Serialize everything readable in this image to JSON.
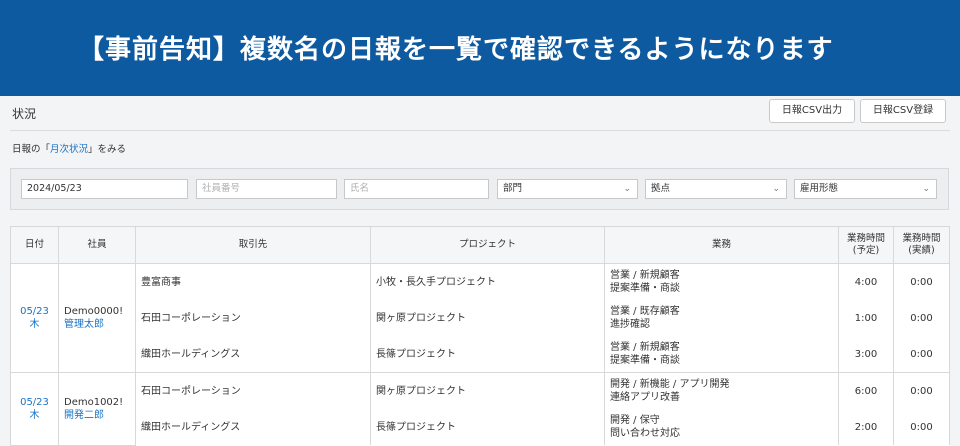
{
  "banner": {
    "text": "【事前告知】複数名の日報を一覧で確認できるようになります"
  },
  "page": {
    "title": "状況",
    "export_button": "日報CSV出力",
    "import_button": "日報CSV登録",
    "link_prefix": "日報の「",
    "link_text": "月次状況",
    "link_suffix": "」をみる"
  },
  "filters": {
    "date": "2024/05/23",
    "employee_no_placeholder": "社員番号",
    "name_placeholder": "氏名",
    "department": "部門",
    "base": "拠点",
    "employment_type": "雇用形態"
  },
  "table": {
    "headers": {
      "date": "日付",
      "employee": "社員",
      "client": "取引先",
      "project": "プロジェクト",
      "work": "業務",
      "planned_1": "業務時間",
      "planned_2": "(予定)",
      "actual_1": "業務時間",
      "actual_2": "(実績)"
    },
    "groups": [
      {
        "date": "05/23 木",
        "employee_id": "Demo0000!",
        "employee_name": "管理太郎",
        "rows": [
          {
            "client": "豊富商事",
            "project": "小牧・長久手プロジェクト",
            "work1": "営業 / 新規顧客",
            "work2": "提案準備・商談",
            "planned": "4:00",
            "actual": "0:00"
          },
          {
            "client": "石田コーポレーション",
            "project": "関ヶ原プロジェクト",
            "work1": "営業 / 既存顧客",
            "work2": "進捗確認",
            "planned": "1:00",
            "actual": "0:00"
          },
          {
            "client": "織田ホールディングス",
            "project": "長篠プロジェクト",
            "work1": "営業 / 新規顧客",
            "work2": "提案準備・商談",
            "planned": "3:00",
            "actual": "0:00"
          }
        ]
      },
      {
        "date": "05/23 木",
        "employee_id": "Demo1002!",
        "employee_name": "開発二郎",
        "rows": [
          {
            "client": "石田コーポレーション",
            "project": "関ヶ原プロジェクト",
            "work1": "開発 / 新機能 / アプリ開発",
            "work2": "連絡アプリ改善",
            "planned": "6:00",
            "actual": "0:00"
          },
          {
            "client": "織田ホールディングス",
            "project": "長篠プロジェクト",
            "work1": "開発 / 保守",
            "work2": "問い合わせ対応",
            "planned": "2:00",
            "actual": "0:00"
          }
        ]
      }
    ]
  },
  "colors": {
    "banner": "#0e5aa0",
    "link": "#1a73c4"
  }
}
